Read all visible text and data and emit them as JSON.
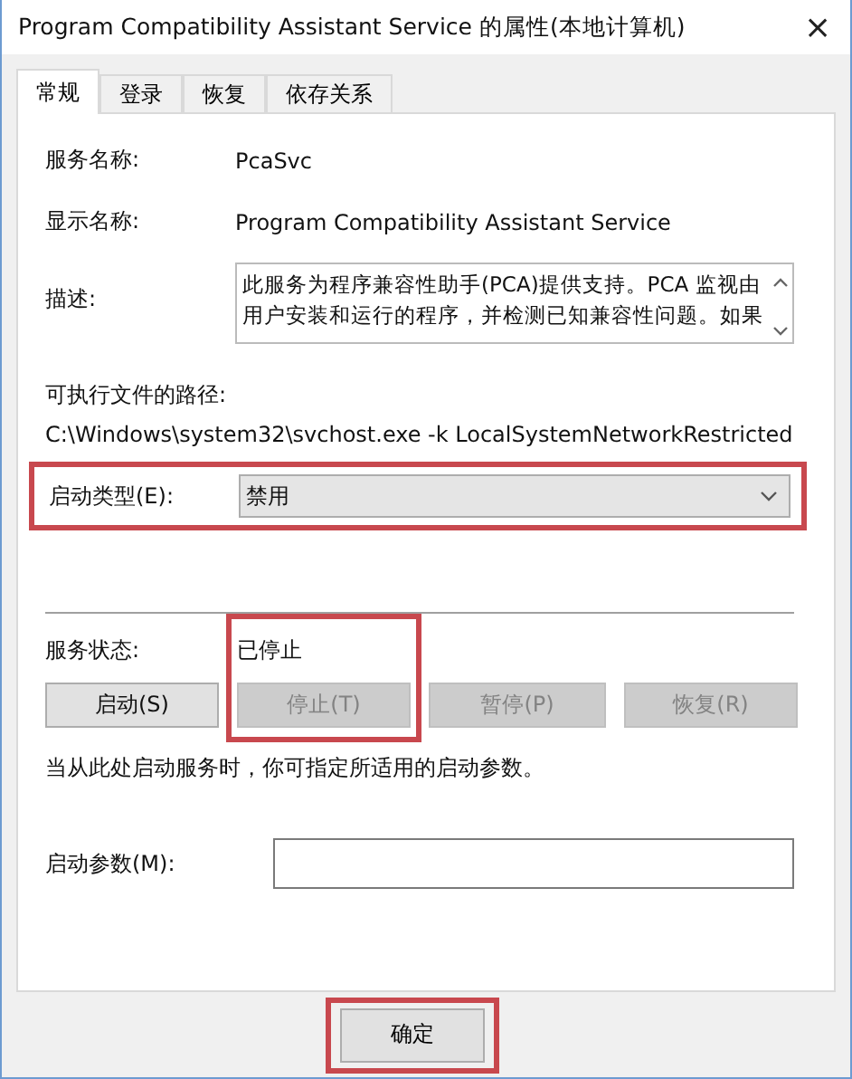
{
  "window": {
    "title": "Program Compatibility Assistant Service 的属性(本地计算机)",
    "close": "×"
  },
  "tabs": [
    {
      "label": "常规",
      "selected": true
    },
    {
      "label": "登录",
      "selected": false
    },
    {
      "label": "恢复",
      "selected": false
    },
    {
      "label": "依存关系",
      "selected": false
    }
  ],
  "service_name": {
    "label": "服务名称:",
    "value": "PcaSvc"
  },
  "display_name": {
    "label": "显示名称:",
    "value": "Program Compatibility Assistant Service"
  },
  "description": {
    "label": "描述:",
    "value": "此服务为程序兼容性助手(PCA)提供支持。PCA 监视由用户安装和运行的程序，并检测已知兼容性问题。如果"
  },
  "executable_path": {
    "label": "可执行文件的路径:",
    "value": "C:\\Windows\\system32\\svchost.exe -k LocalSystemNetworkRestricted"
  },
  "startup_type": {
    "label": "启动类型(E):",
    "value": "禁用",
    "highlighted": true
  },
  "service_status": {
    "label": "服务状态:",
    "value": "已停止",
    "highlighted": true
  },
  "service_buttons": [
    {
      "label": "启动(S)",
      "disabled": false
    },
    {
      "label": "停止(T)",
      "disabled": true
    },
    {
      "label": "暂停(P)",
      "disabled": true
    },
    {
      "label": "恢复(R)",
      "disabled": true
    }
  ],
  "hint": "当从此处启动服务时，你可指定所适用的启动参数。",
  "start_parameters": {
    "label": "启动参数(M):"
  },
  "buttons": [
    {
      "label": "确定",
      "highlighted": true
    }
  ]
}
